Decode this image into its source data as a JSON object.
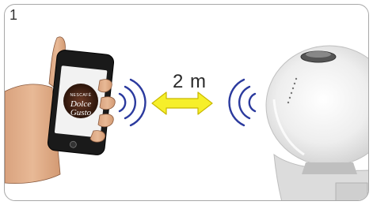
{
  "step": {
    "number": "1"
  },
  "distance": {
    "label": "2 m"
  },
  "logo": {
    "brand": "NESCAFÉ",
    "line1": "Dolce",
    "line2": "Gusto"
  },
  "colors": {
    "signal_waves": "#2b3a9e",
    "arrow_fill": "#f6ef2a",
    "arrow_stroke": "#c9b800",
    "border": "#a8a8a8"
  },
  "icons": {
    "signal_left": "wireless-signal-waves-icon",
    "signal_right": "wireless-signal-waves-icon",
    "arrow": "double-headed-arrow-icon"
  }
}
